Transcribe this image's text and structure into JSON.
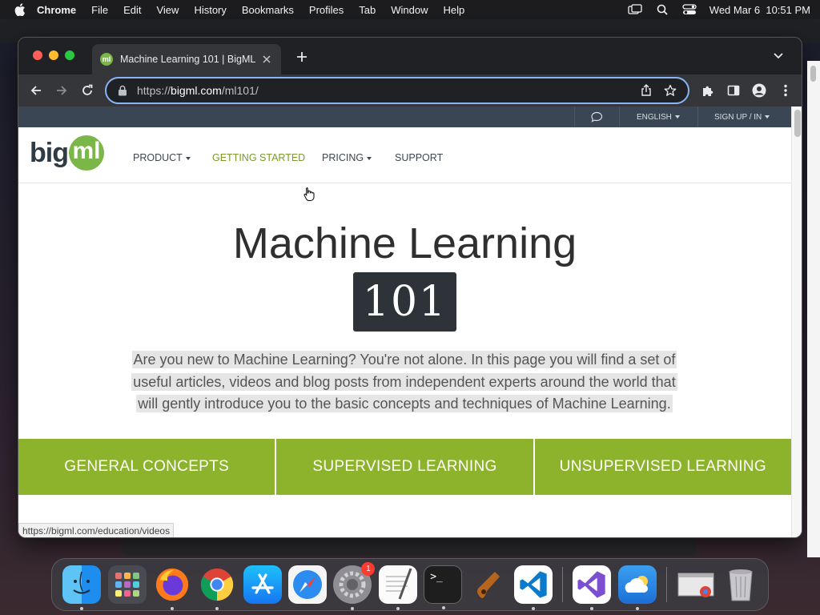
{
  "menubar": {
    "app_name": "Chrome",
    "items": [
      "File",
      "Edit",
      "View",
      "History",
      "Bookmarks",
      "Profiles",
      "Tab",
      "Window",
      "Help"
    ],
    "datetime": "Wed Mar 6  10:51 PM"
  },
  "browser": {
    "tab_title": "Machine Learning 101 | BigML",
    "tab_favicon_text": "ml",
    "url_prefix": "https://",
    "url_host": "bigml.com",
    "url_path": "/ml101/",
    "status_url": "https://bigml.com/education/videos"
  },
  "site": {
    "topbar": {
      "language": "ENGLISH",
      "signup": "SIGN UP / IN"
    },
    "logo": {
      "text_big": "big",
      "text_ml": "ml"
    },
    "nav": {
      "product": "PRODUCT",
      "getting_started": "GETTING STARTED",
      "pricing": "PRICING",
      "support": "SUPPORT"
    },
    "hero": {
      "title": "Machine Learning",
      "badge": "101",
      "intro": "Are you new to Machine Learning? You're not alone. In this page you will find a set of useful articles, videos and blog posts from independent experts around the world that will gently introduce you to the basic concepts and techniques of Machine Learning."
    },
    "categories": [
      "GENERAL CONCEPTS",
      "SUPERVISED LEARNING",
      "UNSUPERVISED LEARNING"
    ]
  },
  "dock": {
    "apps": [
      "finder-icon",
      "launchpad-icon",
      "firefox-icon",
      "chrome-icon",
      "app-store-icon",
      "safari-icon",
      "system-settings-icon",
      "textedit-icon",
      "terminal-icon",
      "garageband-icon",
      "vscode-icon",
      "visual-studio-icon",
      "weather-icon",
      "chrome-window-preview-icon",
      "trash-icon"
    ],
    "settings_badge": "1",
    "terminal_label": ">_"
  },
  "colors": {
    "brand_green": "#8db32c",
    "topbar_bg": "#3a4653",
    "omnibox_focus": "#8ab4f8"
  }
}
